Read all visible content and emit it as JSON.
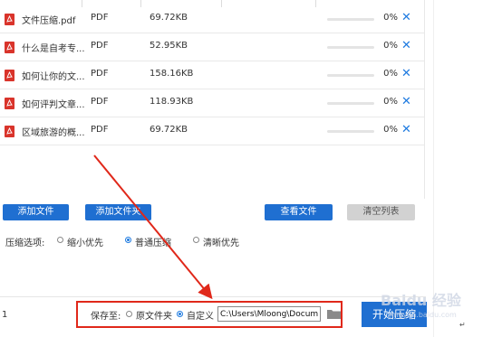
{
  "files": [
    {
      "name": "文件压缩.pdf",
      "type": "PDF",
      "size": "69.72KB",
      "progress": 0,
      "percent": "0%"
    },
    {
      "name": "什么是自考专...",
      "type": "PDF",
      "size": "52.95KB",
      "progress": 0,
      "percent": "0%"
    },
    {
      "name": "如何让你的文...",
      "type": "PDF",
      "size": "158.16KB",
      "progress": 0,
      "percent": "0%"
    },
    {
      "name": "如何评判文章...",
      "type": "PDF",
      "size": "118.93KB",
      "progress": 0,
      "percent": "0%"
    },
    {
      "name": "区域旅游的概...",
      "type": "PDF",
      "size": "69.72KB",
      "progress": 0,
      "percent": "0%"
    }
  ],
  "close_glyph": "✕",
  "buttons": {
    "add_file": "添加文件",
    "add_folder": "添加文件夹",
    "view_file": "查看文件",
    "clear_list": "清空列表",
    "start": "开始压缩"
  },
  "compression": {
    "label": "压缩选项:",
    "options": [
      {
        "label": "缩小优先",
        "selected": false
      },
      {
        "label": "普通压缩",
        "selected": true
      },
      {
        "label": "清晰优先",
        "selected": false
      }
    ]
  },
  "save": {
    "label": "保存至:",
    "options": [
      {
        "label": "原文件夹",
        "selected": false
      },
      {
        "label": "自定义",
        "selected": true
      }
    ],
    "path": "C:\\Users\\Mloong\\Documents"
  },
  "count": "1",
  "watermark": "Baidu 经验",
  "watermark_sub": "jingyan.baidu.com",
  "return_mark": "↵",
  "colors": {
    "accent": "#1f6fd1",
    "highlight": "#e0281a",
    "pdf": "#d9342b"
  }
}
